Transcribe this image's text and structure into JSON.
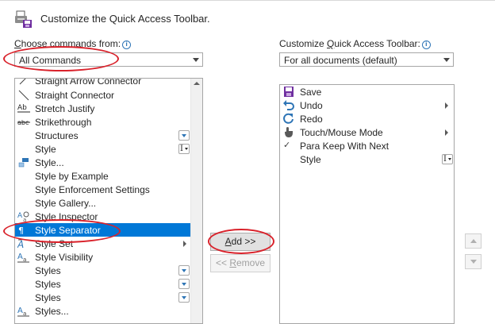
{
  "header": {
    "title": "Customize the Quick Access Toolbar."
  },
  "left": {
    "label_prefix": "",
    "label_access": "C",
    "label_rest": "hoose commands from:",
    "combo_value": "All Commands",
    "items": [
      {
        "label": "Straight Arrow Connector",
        "icon": "arrow-connector-icon"
      },
      {
        "label": "Straight Connector",
        "icon": "straight-line-icon"
      },
      {
        "label": "Stretch Justify",
        "icon": "stretch-justify-icon"
      },
      {
        "label": "Strikethrough",
        "icon": "strikethrough-icon"
      },
      {
        "label": "Structures",
        "icon": ""
      },
      {
        "label": "Style",
        "icon": ""
      },
      {
        "label": "Style...",
        "icon": "style-dialog-icon"
      },
      {
        "label": "Style by Example",
        "icon": ""
      },
      {
        "label": "Style Enforcement Settings",
        "icon": ""
      },
      {
        "label": "Style Gallery...",
        "icon": ""
      },
      {
        "label": "Style Inspector",
        "icon": "style-inspector-icon"
      },
      {
        "label": "Style Separator",
        "icon": "style-separator-icon"
      },
      {
        "label": "Style Set",
        "icon": "style-set-icon"
      },
      {
        "label": "Style Visibility",
        "icon": "style-visibility-icon"
      },
      {
        "label": "Styles",
        "icon": ""
      },
      {
        "label": "Styles",
        "icon": ""
      },
      {
        "label": "Styles",
        "icon": ""
      },
      {
        "label": "Styles...",
        "icon": "styles-dialog-icon"
      }
    ]
  },
  "right": {
    "label_prefix": "Customize ",
    "label_access": "Q",
    "label_rest": "uick Access Toolbar:",
    "combo_value": "For all documents (default)",
    "items": [
      {
        "label": "Save",
        "icon": "save-icon"
      },
      {
        "label": "Undo",
        "icon": "undo-icon"
      },
      {
        "label": "Redo",
        "icon": "redo-icon"
      },
      {
        "label": "Touch/Mouse Mode",
        "icon": "touch-mouse-icon"
      },
      {
        "label": "Para Keep With Next",
        "icon": "checkmark-icon"
      },
      {
        "label": "Style",
        "icon": ""
      }
    ]
  },
  "buttons": {
    "add_access": "A",
    "add_rest": "dd >>",
    "remove_prefix": "<< ",
    "remove_access": "R",
    "remove_rest": "emove"
  },
  "colors": {
    "selection": "#0078d7",
    "annotation": "#d9222b",
    "accent": "#2e75b6"
  }
}
